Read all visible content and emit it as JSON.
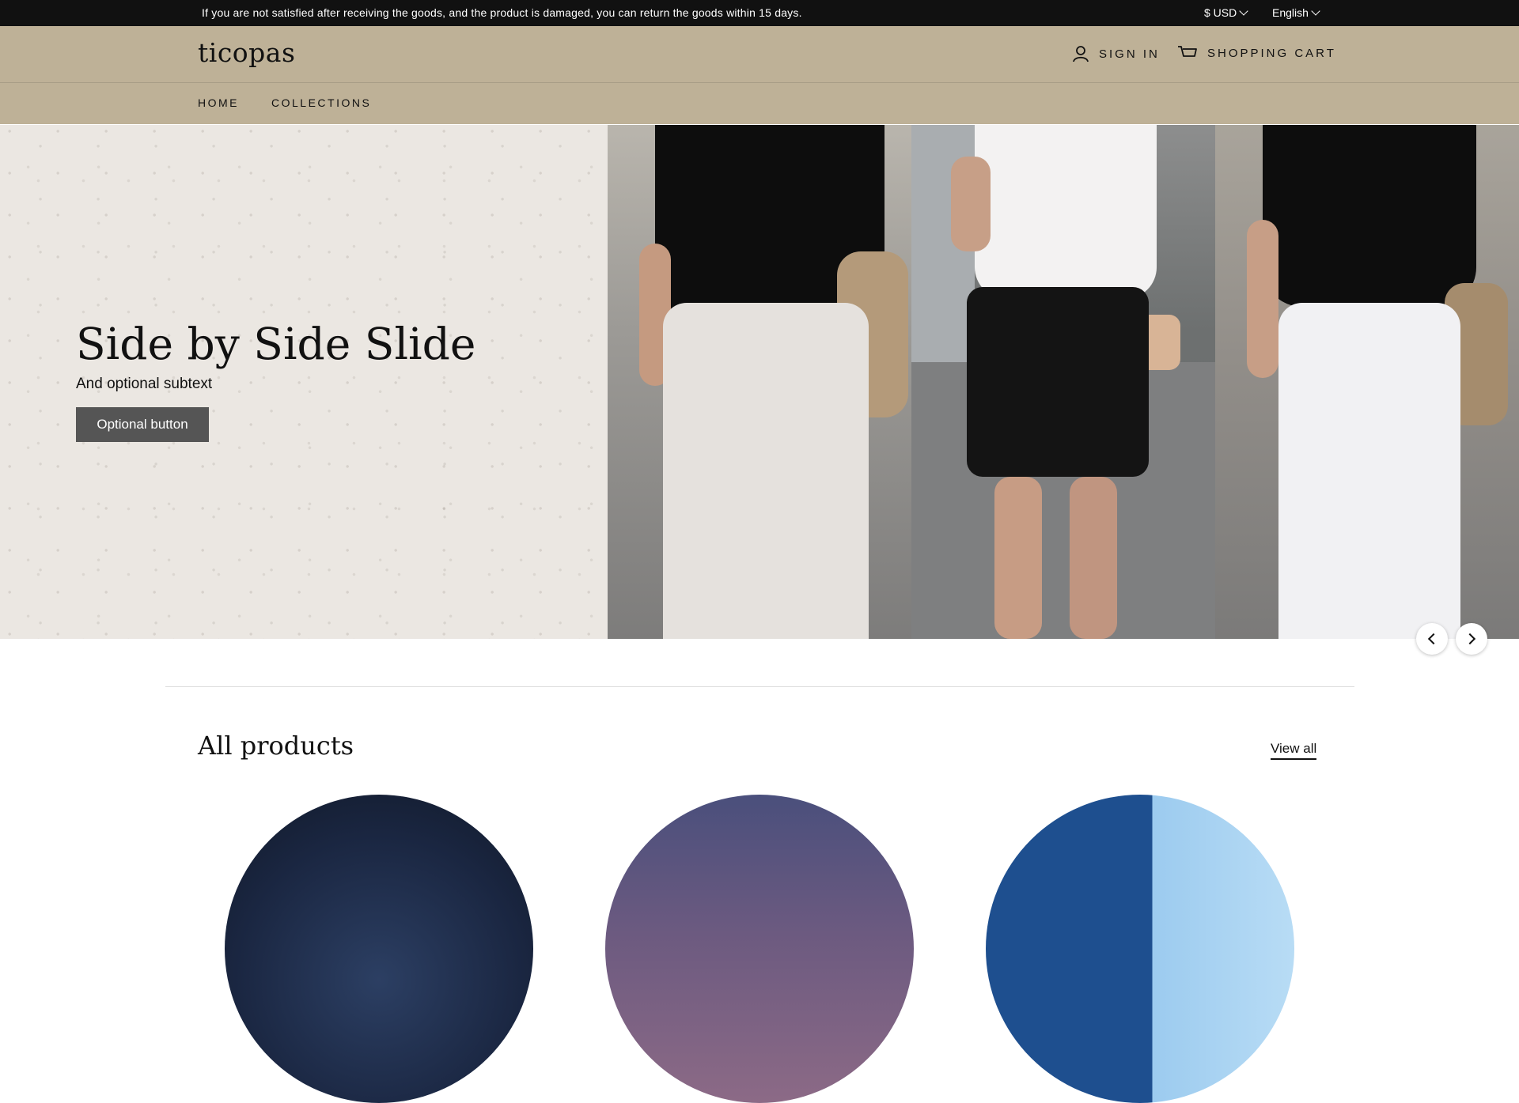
{
  "announcement": "If you are not satisfied after receiving the goods, and the product is damaged, you can return the goods within 15 days.",
  "currency": "$ USD",
  "language": "English",
  "header": {
    "logo": "ticopas",
    "sign_in": "SIGN IN",
    "cart": "SHOPPING CART"
  },
  "nav": {
    "items": [
      "HOME",
      "COLLECTIONS"
    ]
  },
  "hero": {
    "title": "Side by Side Slide",
    "subtext": "And optional subtext",
    "button": "Optional button"
  },
  "products_section": {
    "title": "All products",
    "view_all": "View all"
  },
  "colors": {
    "announcement_bg": "#111111",
    "header_bg": "#beb197",
    "hero_left_bg": "#ebe7e2",
    "button_bg": "#555555"
  },
  "icons": {
    "sign_in": "user-icon",
    "cart": "cart-icon",
    "dropdown": "chevron-down-icon",
    "carousel_prev": "chevron-left-icon",
    "carousel_next": "chevron-right-icon"
  }
}
